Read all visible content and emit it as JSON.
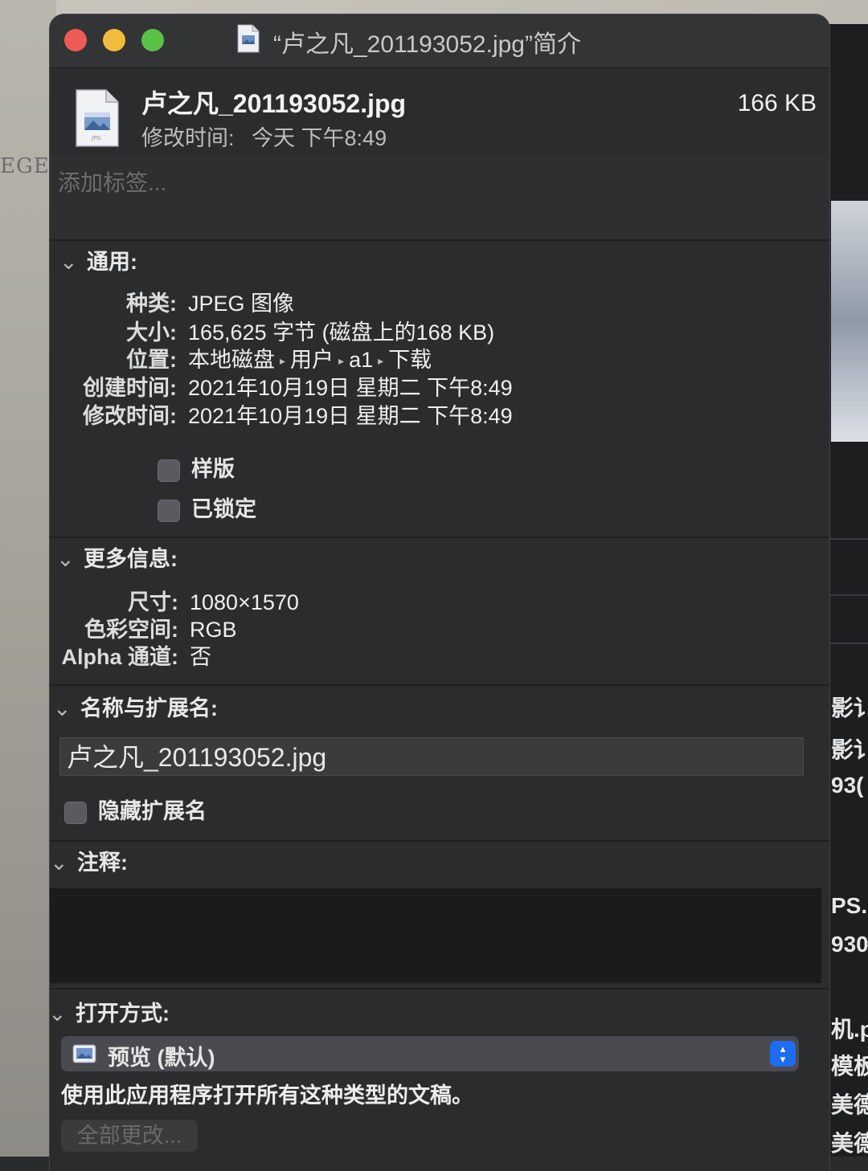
{
  "background": {
    "left_text": "EGEI",
    "right_texts": [
      "影讠",
      "影讠",
      "93(",
      "PS.I",
      "930",
      "机.p",
      "模板",
      "美德",
      "美德"
    ]
  },
  "window": {
    "title": "“卢之凡_201193052.jpg”简介"
  },
  "header": {
    "filename": "卢之凡_201193052.jpg",
    "modified_label": "修改时间:",
    "modified_value": "今天 下午8:49",
    "size": "166 KB",
    "tags_placeholder": "添加标签..."
  },
  "general": {
    "title": "通用:",
    "rows": [
      {
        "label": "种类:",
        "value": "JPEG 图像"
      },
      {
        "label": "大小:",
        "value": "165,625 字节 (磁盘上的168 KB)"
      },
      {
        "label": "位置:",
        "path": [
          "本地磁盘",
          "用户",
          "a1",
          "下载"
        ]
      },
      {
        "label": "创建时间:",
        "value": "2021年10月19日 星期二 下午8:49"
      },
      {
        "label": "修改时间:",
        "value": "2021年10月19日 星期二 下午8:49"
      }
    ],
    "stationery_label": "样版",
    "locked_label": "已锁定",
    "stationery_checked": false,
    "locked_checked": false
  },
  "more_info": {
    "title": "更多信息:",
    "rows": [
      {
        "label": "尺寸:",
        "value": "1080×1570"
      },
      {
        "label": "色彩空间:",
        "value": "RGB"
      },
      {
        "label": "Alpha 通道:",
        "value": "否"
      }
    ]
  },
  "name_ext": {
    "title": "名称与扩展名:",
    "value": "卢之凡_201193052.jpg",
    "hide_ext_label": "隐藏扩展名",
    "hide_ext_checked": false
  },
  "comments": {
    "title": "注释:",
    "value": ""
  },
  "open_with": {
    "title": "打开方式:",
    "app": "预览 (默认)",
    "description": "使用此应用程序打开所有这种类型的文稿。",
    "change_all_label": "全部更改..."
  },
  "colors": {
    "close": "#ed5b55",
    "minimize": "#f2bb3b",
    "zoom": "#58c247",
    "accent": "#1e6cf2"
  }
}
